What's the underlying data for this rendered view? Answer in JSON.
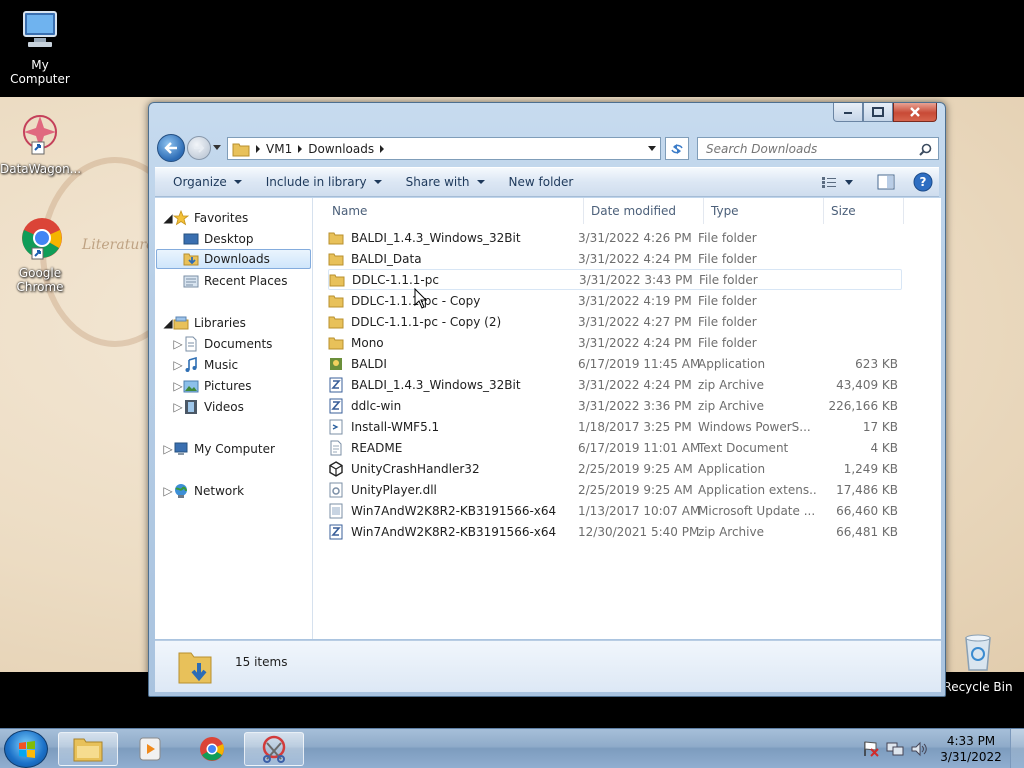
{
  "desktop": {
    "icons": [
      {
        "label": "My Computer"
      },
      {
        "label": "DataWagon..."
      },
      {
        "label": "Google Chrome"
      },
      {
        "label": "Recycle Bin"
      }
    ],
    "wallpaper_text": "Literature"
  },
  "window": {
    "address": {
      "segments": [
        "VM1",
        "Downloads"
      ]
    },
    "search": {
      "placeholder": "Search Downloads"
    },
    "toolbar": {
      "organize": "Organize",
      "include_in_library": "Include in library",
      "share_with": "Share with",
      "new_folder": "New folder"
    },
    "nav": {
      "favorites": "Favorites",
      "desktop": "Desktop",
      "downloads": "Downloads",
      "recent_places": "Recent Places",
      "libraries": "Libraries",
      "documents": "Documents",
      "music": "Music",
      "pictures": "Pictures",
      "videos": "Videos",
      "my_computer": "My Computer",
      "network": "Network"
    },
    "columns": {
      "name": "Name",
      "date": "Date modified",
      "type": "Type",
      "size": "Size"
    },
    "files": [
      {
        "name": "BALDI_1.4.3_Windows_32Bit",
        "date": "3/31/2022 4:26 PM",
        "type": "File folder",
        "size": "",
        "icon": "folder-icon"
      },
      {
        "name": "BALDI_Data",
        "date": "3/31/2022 4:24 PM",
        "type": "File folder",
        "size": "",
        "icon": "folder-icon"
      },
      {
        "name": "DDLC-1.1.1-pc",
        "date": "3/31/2022 3:43 PM",
        "type": "File folder",
        "size": "",
        "icon": "folder-icon"
      },
      {
        "name": "DDLC-1.1.1-pc - Copy",
        "date": "3/31/2022 4:19 PM",
        "type": "File folder",
        "size": "",
        "icon": "folder-icon"
      },
      {
        "name": "DDLC-1.1.1-pc - Copy (2)",
        "date": "3/31/2022 4:27 PM",
        "type": "File folder",
        "size": "",
        "icon": "folder-icon"
      },
      {
        "name": "Mono",
        "date": "3/31/2022 4:24 PM",
        "type": "File folder",
        "size": "",
        "icon": "folder-icon"
      },
      {
        "name": "BALDI",
        "date": "6/17/2019 11:45 AM",
        "type": "Application",
        "size": "623 KB",
        "icon": "app-icon"
      },
      {
        "name": "BALDI_1.4.3_Windows_32Bit",
        "date": "3/31/2022 4:24 PM",
        "type": "zip Archive",
        "size": "43,409 KB",
        "icon": "zip-icon"
      },
      {
        "name": "ddlc-win",
        "date": "3/31/2022 3:36 PM",
        "type": "zip Archive",
        "size": "226,166 KB",
        "icon": "zip-icon"
      },
      {
        "name": "Install-WMF5.1",
        "date": "1/18/2017 3:25 PM",
        "type": "Windows PowerS...",
        "size": "17 KB",
        "icon": "script-icon"
      },
      {
        "name": "README",
        "date": "6/17/2019 11:01 AM",
        "type": "Text Document",
        "size": "4 KB",
        "icon": "text-file-icon"
      },
      {
        "name": "UnityCrashHandler32",
        "date": "2/25/2019 9:25 AM",
        "type": "Application",
        "size": "1,249 KB",
        "icon": "unity-icon"
      },
      {
        "name": "UnityPlayer.dll",
        "date": "2/25/2019 9:25 AM",
        "type": "Application extens...",
        "size": "17,486 KB",
        "icon": "dll-icon"
      },
      {
        "name": "Win7AndW2K8R2-KB3191566-x64",
        "date": "1/13/2017 10:07 AM",
        "type": "Microsoft Update ...",
        "size": "66,460 KB",
        "icon": "update-icon"
      },
      {
        "name": "Win7AndW2K8R2-KB3191566-x64",
        "date": "12/30/2021 5:40 PM",
        "type": "zip Archive",
        "size": "66,481 KB",
        "icon": "zip-icon"
      }
    ],
    "status": {
      "count": "15 items"
    }
  },
  "taskbar": {
    "clock": {
      "time": "4:33 PM",
      "date": "3/31/2022"
    }
  },
  "colors": {
    "accent": "#2d6cb5",
    "folder": "#e8c15a",
    "selection": "#cfe6fb"
  }
}
